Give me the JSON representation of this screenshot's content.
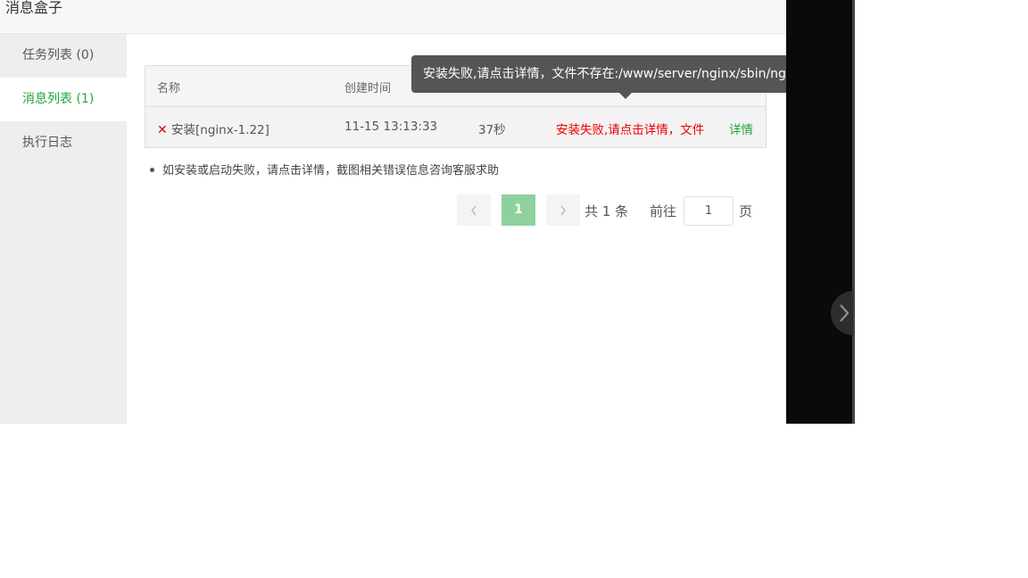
{
  "dialog": {
    "title": "消息盒子"
  },
  "sidebar": {
    "items": [
      {
        "label": "任务列表 (0)"
      },
      {
        "label": "消息列表 (1)"
      },
      {
        "label": "执行日志"
      }
    ]
  },
  "table": {
    "headers": {
      "name": "名称",
      "created": "创建时间"
    },
    "rows": [
      {
        "name": "安装[nginx-1.22]",
        "created": "11-15 13:13:33",
        "duration": "37秒",
        "status": "安装失败,请点击详情，文件不存在:/www/server/nginx/sbin/nginx",
        "action": "详情"
      }
    ]
  },
  "tip": "如安装或启动失败，请点击详情，截图相关错误信息咨询客服求助",
  "pagination": {
    "current": "1",
    "total": "共 1 条",
    "goto_label": "前往",
    "goto_value": "1",
    "goto_suffix": "页"
  },
  "tooltip": {
    "text": "安装失败,请点击详情，文件不存在:/www/server/nginx/sbin/nginx"
  },
  "colors": {
    "accent": "#20a53a",
    "error": "#ee0000",
    "tooltip_bg": "#555555",
    "page_active": "#8fd19e"
  },
  "icons": {
    "row_status": "close-icon",
    "prev": "chevron-left-icon",
    "next": "chevron-right-icon",
    "panel_next": "chevron-right-icon"
  }
}
